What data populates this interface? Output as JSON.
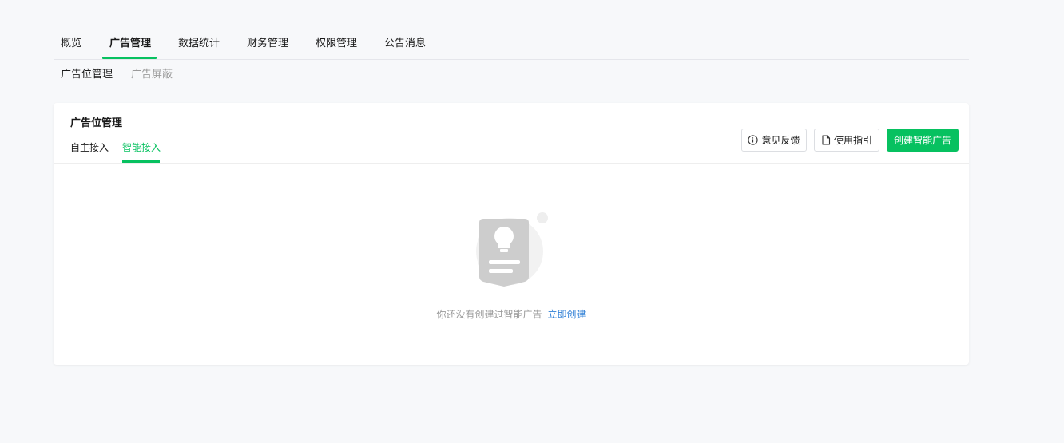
{
  "top_nav": {
    "tabs": [
      "概览",
      "广告管理",
      "数据统计",
      "财务管理",
      "权限管理",
      "公告消息"
    ],
    "active_index": 1
  },
  "sub_nav": {
    "tabs": [
      "广告位管理",
      "广告屏蔽"
    ],
    "active_index": 0
  },
  "card": {
    "title": "广告位管理",
    "tabs": [
      "自主接入",
      "智能接入"
    ],
    "active_tab_index": 1,
    "buttons": {
      "feedback": {
        "label": "意见反馈",
        "icon": "info-circle-icon"
      },
      "guide": {
        "label": "使用指引",
        "icon": "document-icon"
      },
      "create": {
        "label": "创建智能广告"
      }
    }
  },
  "empty_state": {
    "icon": "lightbulb-document-icon",
    "message": "你还没有创建过智能广告",
    "action": "立即创建"
  },
  "colors": {
    "accent": "#07c160",
    "link": "#2f7fd6",
    "page_background": "#f7f8fa"
  }
}
